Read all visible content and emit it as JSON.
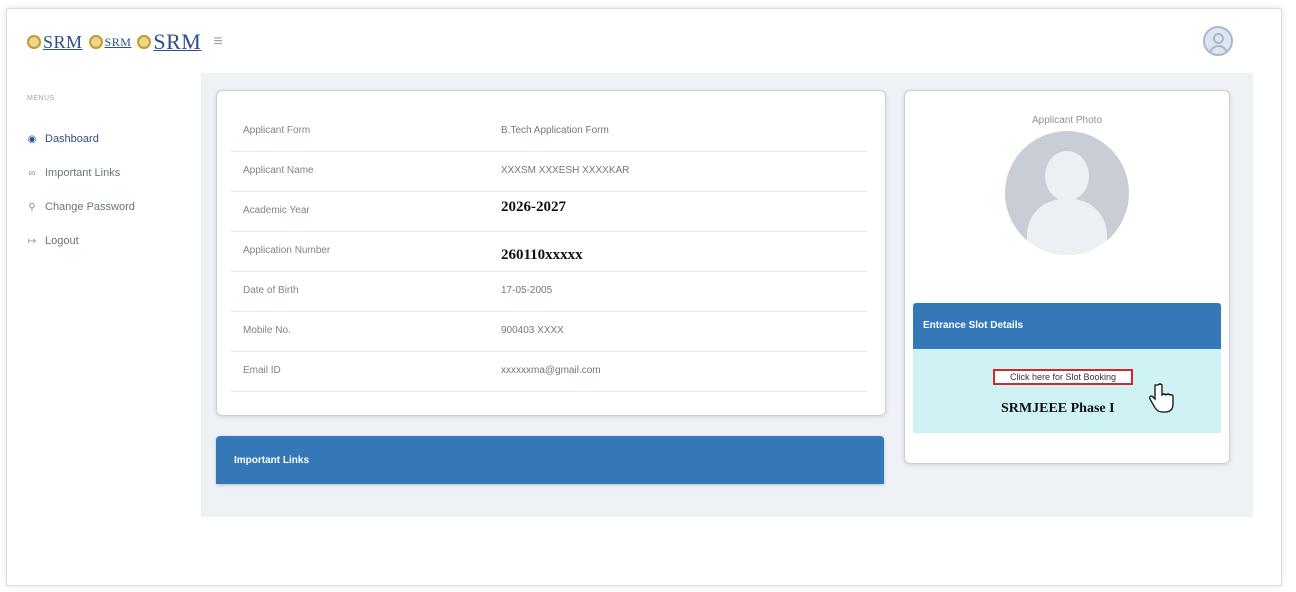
{
  "header": {
    "logos": [
      "SRM",
      "SRM",
      "SRM"
    ],
    "menu_icon": "hamburger-icon",
    "profile_icon": "user-avatar-icon"
  },
  "sidebar": {
    "section_label": "MENUS",
    "items": [
      {
        "label": "Dashboard",
        "icon": "dashboard-icon",
        "active": true
      },
      {
        "label": "Important Links",
        "icon": "link-icon",
        "active": false
      },
      {
        "label": "Change Password",
        "icon": "key-icon",
        "active": false
      },
      {
        "label": "Logout",
        "icon": "logout-icon",
        "active": false
      }
    ]
  },
  "applicant": {
    "rows": [
      {
        "label": "Applicant Form",
        "value": "B.Tech Application Form"
      },
      {
        "label": "Applicant Name",
        "value": "XXXSM XXXESH XXXXKAR"
      },
      {
        "label": "Academic Year",
        "value": "2026-2027"
      },
      {
        "label": "Application Number",
        "value": "260110xxxxx"
      },
      {
        "label": "Date of Birth",
        "value": "17-05-2005"
      },
      {
        "label": "Mobile No.",
        "value": "900403 XXXX"
      },
      {
        "label": "Email ID",
        "value": "xxxxxxma@gmail.com"
      }
    ]
  },
  "important_links": {
    "title": "Important Links"
  },
  "photo": {
    "title": "Applicant Photo"
  },
  "slot": {
    "title": "Entrance Slot Details",
    "button_label": "Click here for Slot Booking",
    "phase": "SRMJEEE Phase I"
  },
  "colors": {
    "accent": "#3578b8",
    "highlight_border": "#d2292c",
    "slot_bg": "#cff2f4"
  }
}
